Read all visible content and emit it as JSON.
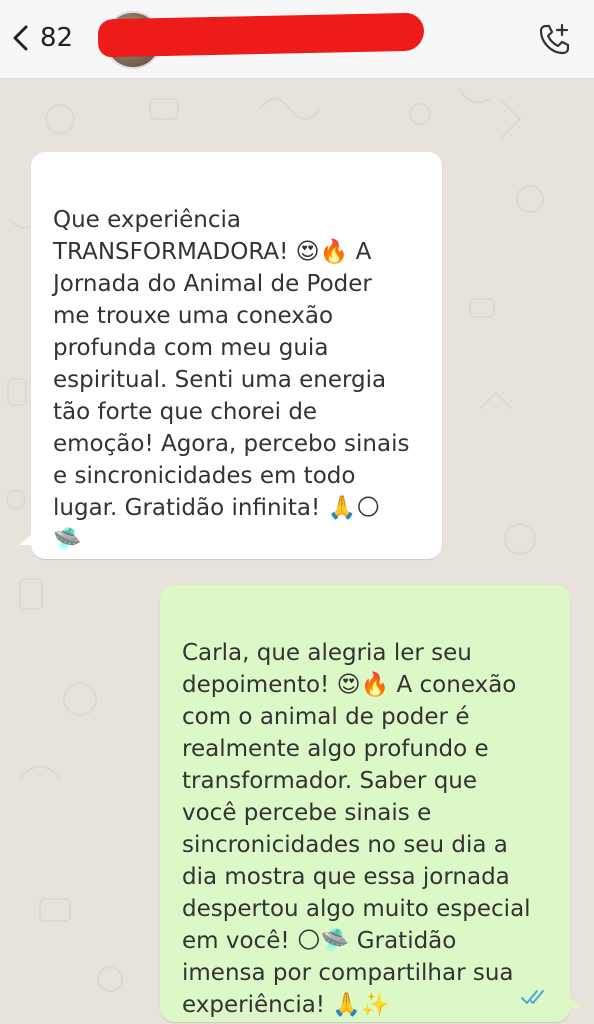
{
  "header": {
    "back_count": "82",
    "contact_name_redacted": true
  },
  "messages": [
    {
      "direction": "incoming",
      "text": "Que experiência\nTRANSFORMADORA! 😍🔥 A\nJornada do Animal de Poder\nme trouxe uma conexão\nprofunda com meu guia\nespiritual. Senti uma energia\ntão forte que chorei de\nemoção! Agora, percebo sinais\ne sincronicidades em todo\nlugar. Gratidão infinita! 🙏🌕\n🛸"
    },
    {
      "direction": "outgoing",
      "text": "Carla, que alegria ler seu\ndepoimento! 😍🔥 A conexão\ncom o animal de poder é\nrealmente algo profundo e\ntransformador. Saber que\nvocê percebe sinais e\nsincronicidades no seu dia a\ndia mostra que essa jornada\ndespertou algo muito especial\nem você! 🌕🛸 Gratidão\nimensa por compartilhar sua\nexperiência! 🙏✨",
      "status": "read"
    }
  ],
  "colors": {
    "incoming_bubble": "#ffffff",
    "outgoing_bubble": "#dcf8c6",
    "chat_background": "#e8e3da",
    "read_ticks": "#4fa8d8",
    "redaction": "#ee1b1b"
  }
}
